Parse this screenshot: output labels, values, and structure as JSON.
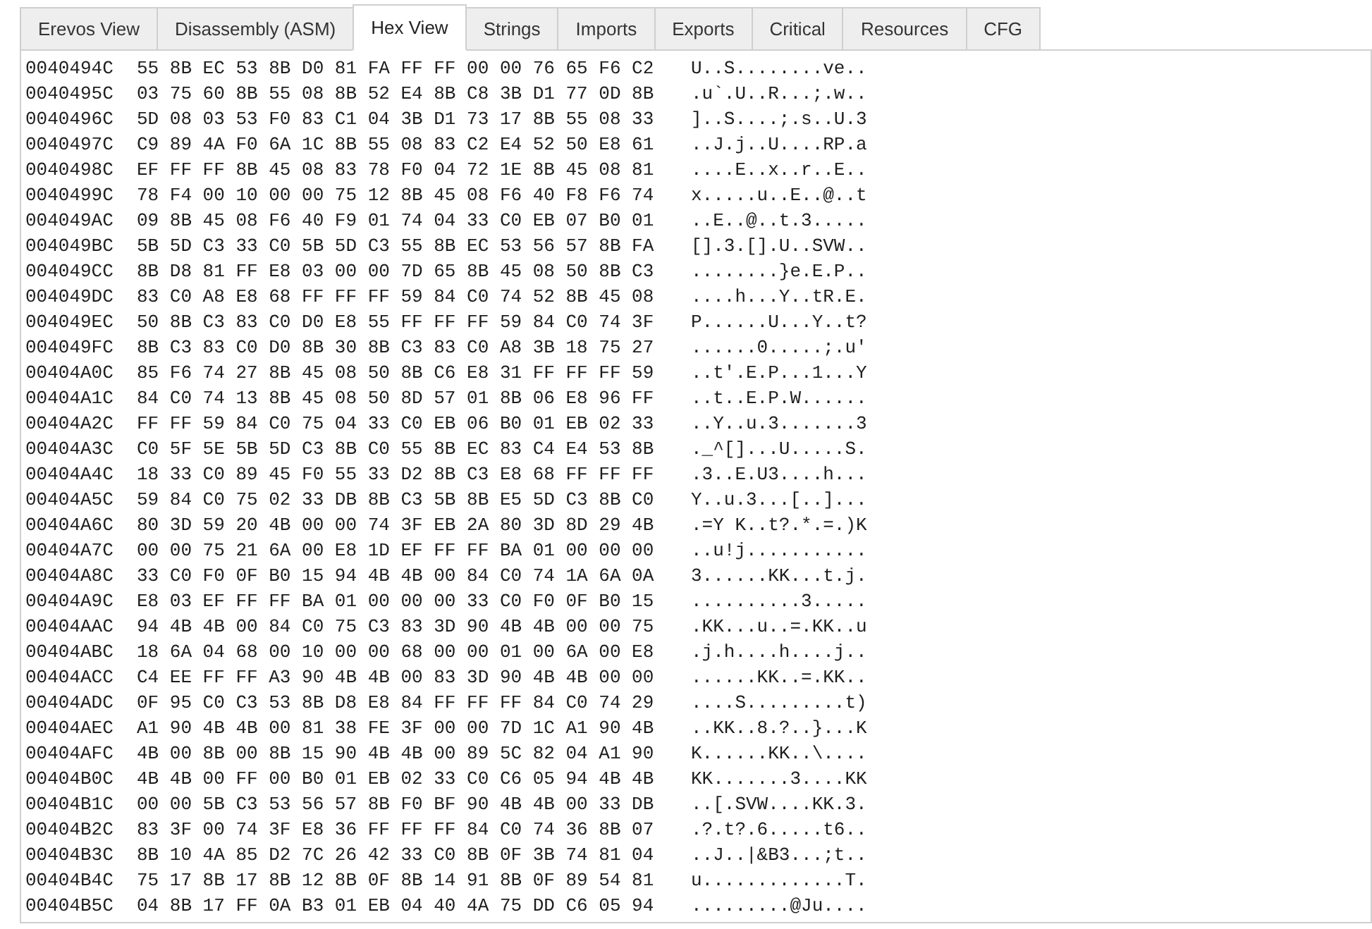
{
  "tabs": [
    {
      "label": "Erevos View",
      "selected": false
    },
    {
      "label": "Disassembly (ASM)",
      "selected": false
    },
    {
      "label": "Hex View",
      "selected": true
    },
    {
      "label": "Strings",
      "selected": false
    },
    {
      "label": "Imports",
      "selected": false
    },
    {
      "label": "Exports",
      "selected": false
    },
    {
      "label": "Critical",
      "selected": false
    },
    {
      "label": "Resources",
      "selected": false
    },
    {
      "label": "CFG",
      "selected": false
    }
  ],
  "rows": [
    {
      "address": "0040494C",
      "bytes": "55 8B EC 53 8B D0 81 FA FF FF 00 00 76 65 F6 C2",
      "ascii": "U..S........ve.."
    },
    {
      "address": "0040495C",
      "bytes": "03 75 60 8B 55 08 8B 52 E4 8B C8 3B D1 77 0D 8B",
      "ascii": ".u`.U..R...;.w.."
    },
    {
      "address": "0040496C",
      "bytes": "5D 08 03 53 F0 83 C1 04 3B D1 73 17 8B 55 08 33",
      "ascii": "]..S....;.s..U.3"
    },
    {
      "address": "0040497C",
      "bytes": "C9 89 4A F0 6A 1C 8B 55 08 83 C2 E4 52 50 E8 61",
      "ascii": "..J.j..U....RP.a"
    },
    {
      "address": "0040498C",
      "bytes": "EF FF FF 8B 45 08 83 78 F0 04 72 1E 8B 45 08 81",
      "ascii": "....E..x..r..E.."
    },
    {
      "address": "0040499C",
      "bytes": "78 F4 00 10 00 00 75 12 8B 45 08 F6 40 F8 F6 74",
      "ascii": "x.....u..E..@..t"
    },
    {
      "address": "004049AC",
      "bytes": "09 8B 45 08 F6 40 F9 01 74 04 33 C0 EB 07 B0 01",
      "ascii": "..E..@..t.3....."
    },
    {
      "address": "004049BC",
      "bytes": "5B 5D C3 33 C0 5B 5D C3 55 8B EC 53 56 57 8B FA",
      "ascii": "[].3.[].U..SVW.."
    },
    {
      "address": "004049CC",
      "bytes": "8B D8 81 FF E8 03 00 00 7D 65 8B 45 08 50 8B C3",
      "ascii": "........}e.E.P.."
    },
    {
      "address": "004049DC",
      "bytes": "83 C0 A8 E8 68 FF FF FF 59 84 C0 74 52 8B 45 08",
      "ascii": "....h...Y..tR.E."
    },
    {
      "address": "004049EC",
      "bytes": "50 8B C3 83 C0 D0 E8 55 FF FF FF 59 84 C0 74 3F",
      "ascii": "P......U...Y..t?"
    },
    {
      "address": "004049FC",
      "bytes": "8B C3 83 C0 D0 8B 30 8B C3 83 C0 A8 3B 18 75 27",
      "ascii": "......0.....;.u'"
    },
    {
      "address": "00404A0C",
      "bytes": "85 F6 74 27 8B 45 08 50 8B C6 E8 31 FF FF FF 59",
      "ascii": "..t'.E.P...1...Y"
    },
    {
      "address": "00404A1C",
      "bytes": "84 C0 74 13 8B 45 08 50 8D 57 01 8B 06 E8 96 FF",
      "ascii": "..t..E.P.W......"
    },
    {
      "address": "00404A2C",
      "bytes": "FF FF 59 84 C0 75 04 33 C0 EB 06 B0 01 EB 02 33",
      "ascii": "..Y..u.3.......3"
    },
    {
      "address": "00404A3C",
      "bytes": "C0 5F 5E 5B 5D C3 8B C0 55 8B EC 83 C4 E4 53 8B",
      "ascii": "._^[]...U.....S."
    },
    {
      "address": "00404A4C",
      "bytes": "18 33 C0 89 45 F0 55 33 D2 8B C3 E8 68 FF FF FF",
      "ascii": ".3..E.U3....h..."
    },
    {
      "address": "00404A5C",
      "bytes": "59 84 C0 75 02 33 DB 8B C3 5B 8B E5 5D C3 8B C0",
      "ascii": "Y..u.3...[..]..."
    },
    {
      "address": "00404A6C",
      "bytes": "80 3D 59 20 4B 00 00 74 3F EB 2A 80 3D 8D 29 4B",
      "ascii": ".=Y K..t?.*.=.)K"
    },
    {
      "address": "00404A7C",
      "bytes": "00 00 75 21 6A 00 E8 1D EF FF FF BA 01 00 00 00",
      "ascii": "..u!j..........."
    },
    {
      "address": "00404A8C",
      "bytes": "33 C0 F0 0F B0 15 94 4B 4B 00 84 C0 74 1A 6A 0A",
      "ascii": "3......KK...t.j."
    },
    {
      "address": "00404A9C",
      "bytes": "E8 03 EF FF FF BA 01 00 00 00 33 C0 F0 0F B0 15",
      "ascii": "..........3....."
    },
    {
      "address": "00404AAC",
      "bytes": "94 4B 4B 00 84 C0 75 C3 83 3D 90 4B 4B 00 00 75",
      "ascii": ".KK...u..=.KK..u"
    },
    {
      "address": "00404ABC",
      "bytes": "18 6A 04 68 00 10 00 00 68 00 00 01 00 6A 00 E8",
      "ascii": ".j.h....h....j.."
    },
    {
      "address": "00404ACC",
      "bytes": "C4 EE FF FF A3 90 4B 4B 00 83 3D 90 4B 4B 00 00",
      "ascii": "......KK..=.KK.."
    },
    {
      "address": "00404ADC",
      "bytes": "0F 95 C0 C3 53 8B D8 E8 84 FF FF FF 84 C0 74 29",
      "ascii": "....S.........t)"
    },
    {
      "address": "00404AEC",
      "bytes": "A1 90 4B 4B 00 81 38 FE 3F 00 00 7D 1C A1 90 4B",
      "ascii": "..KK..8.?..}...K"
    },
    {
      "address": "00404AFC",
      "bytes": "4B 00 8B 00 8B 15 90 4B 4B 00 89 5C 82 04 A1 90",
      "ascii": "K......KK..\\...."
    },
    {
      "address": "00404B0C",
      "bytes": "4B 4B 00 FF 00 B0 01 EB 02 33 C0 C6 05 94 4B 4B",
      "ascii": "KK.......3....KK"
    },
    {
      "address": "00404B1C",
      "bytes": "00 00 5B C3 53 56 57 8B F0 BF 90 4B 4B 00 33 DB",
      "ascii": "..[.SVW....KK.3."
    },
    {
      "address": "00404B2C",
      "bytes": "83 3F 00 74 3F E8 36 FF FF FF 84 C0 74 36 8B 07",
      "ascii": ".?.t?.6.....t6.."
    },
    {
      "address": "00404B3C",
      "bytes": "8B 10 4A 85 D2 7C 26 42 33 C0 8B 0F 3B 74 81 04",
      "ascii": "..J..|&B3...;t.."
    },
    {
      "address": "00404B4C",
      "bytes": "75 17 8B 17 8B 12 8B 0F 8B 14 91 8B 0F 89 54 81",
      "ascii": "u.............T."
    },
    {
      "address": "00404B5C",
      "bytes": "04 8B 17 FF 0A B3 01 EB 04 40 4A 75 DD C6 05 94",
      "ascii": ".........@Ju...."
    }
  ]
}
